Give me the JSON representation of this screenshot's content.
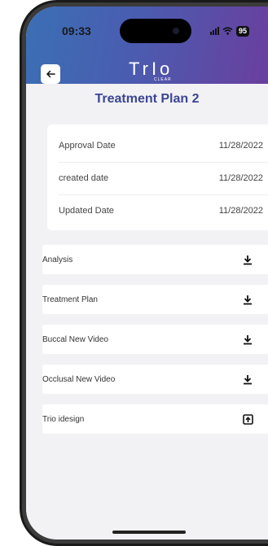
{
  "status_bar": {
    "time": "09:33",
    "battery": "95"
  },
  "header": {
    "logo_text": "TrIo",
    "logo_subtext": "CLEAR",
    "back_icon": "arrow-left-icon"
  },
  "page": {
    "title": "Treatment Plan 2"
  },
  "info": [
    {
      "label": "Approval Date",
      "value": "11/28/2022"
    },
    {
      "label": "created date",
      "value": "11/28/2022"
    },
    {
      "label": "Updated Date",
      "value": "11/28/2022"
    }
  ],
  "files": [
    {
      "label": "Analysis",
      "icon": "download-icon"
    },
    {
      "label": "Treatment Plan",
      "icon": "download-icon"
    },
    {
      "label": "Buccal New Video",
      "icon": "download-icon"
    },
    {
      "label": "Occlusal New Video",
      "icon": "download-icon"
    },
    {
      "label": "Trio idesign",
      "icon": "open-external-icon"
    }
  ],
  "colors": {
    "title": "#3d4594",
    "header_start": "#3b6fb5",
    "header_end": "#6a3f9e"
  }
}
